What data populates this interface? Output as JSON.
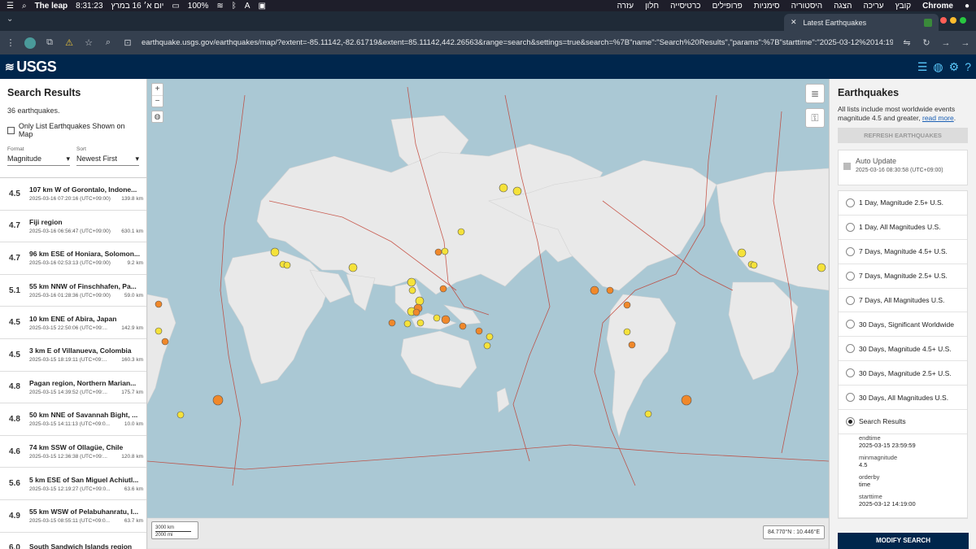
{
  "menubar": {
    "app_name": "The leap",
    "time": "8:31:23",
    "date": "יום א׳ 16 במרץ",
    "battery": "100%",
    "menus": [
      "עזרה",
      "חלון",
      "כרטיסייה",
      "פרופילים",
      "סימניות",
      "היסטוריה",
      "הצגה",
      "עריכה",
      "קובץ"
    ],
    "browser": "Chrome"
  },
  "tab": {
    "title": "Latest Earthquakes"
  },
  "address": {
    "url": "earthquake.usgs.gov/earthquakes/map/?extent=-85.11142,-82.61719&extent=85.11142,442.26563&range=search&settings=true&search=%7B\"name\":\"Search%20Results\",\"params\":%7B\"starttime\":\"2025-03-12%2014:19:..."
  },
  "header": {
    "logo": "USGS"
  },
  "left": {
    "title": "Search Results",
    "count": "36 earthquakes.",
    "only_list_label": "Only List Earthquakes Shown on Map",
    "format_label": "Format",
    "format_value": "Magnitude",
    "sort_label": "Sort",
    "sort_value": "Newest First",
    "quakes": [
      {
        "mag": "4.5",
        "place": "107 km W of Gorontalo, Indone...",
        "time": "2025-03-16 07:20:16 (UTC+09:00)",
        "depth": "139.8 km"
      },
      {
        "mag": "4.7",
        "place": "Fiji region",
        "time": "2025-03-16 06:56:47 (UTC+09:00)",
        "depth": "630.1 km"
      },
      {
        "mag": "4.7",
        "place": "96 km ESE of Honiara, Solomon...",
        "time": "2025-03-16 02:53:13 (UTC+09:00)",
        "depth": "9.2 km"
      },
      {
        "mag": "5.1",
        "place": "55 km NNW of Finschhafen, Pa...",
        "time": "2025-03-16 01:28:36 (UTC+09:00)",
        "depth": "59.0 km"
      },
      {
        "mag": "4.5",
        "place": "10 km ENE of Abira, Japan",
        "time": "2025-03-15 22:50:06 (UTC+09:...",
        "depth": "142.9 km"
      },
      {
        "mag": "4.5",
        "place": "3 km E of Villanueva, Colombia",
        "time": "2025-03-15 18:19:11 (UTC+09:...",
        "depth": "160.3 km"
      },
      {
        "mag": "4.8",
        "place": "Pagan region, Northern Marian...",
        "time": "2025-03-15 14:39:52 (UTC+09:...",
        "depth": "175.7 km"
      },
      {
        "mag": "4.8",
        "place": "50 km NNE of Savannah Bight, ...",
        "time": "2025-03-15 14:11:13 (UTC+09:0...",
        "depth": "10.0 km"
      },
      {
        "mag": "4.6",
        "place": "74 km SSW of Ollagüe, Chile",
        "time": "2025-03-15 12:36:38 (UTC+09:...",
        "depth": "120.8 km"
      },
      {
        "mag": "5.6",
        "place": "5 km ESE of San Miguel Achiutl...",
        "time": "2025-03-15 12:19:27 (UTC+09:0...",
        "depth": "63.6 km"
      },
      {
        "mag": "4.9",
        "place": "55 km WSW of Pelabuhanratu, I...",
        "time": "2025-03-15 08:55:11 (UTC+09:0...",
        "depth": "63.7 km"
      },
      {
        "mag": "6.0",
        "place": "South Sandwich Islands region",
        "time": "",
        "depth": ""
      }
    ]
  },
  "map": {
    "scale_km": "3000 km",
    "scale_mi": "2000 mi",
    "coords": "84.770°N : 10.446°E"
  },
  "right": {
    "title": "Earthquakes",
    "desc": "All lists include most worldwide events magnitude 4.5 and greater,",
    "read_more": "read more",
    "refresh": "REFRESH EARTHQUAKES",
    "auto_update": "Auto Update",
    "auto_update_time": "2025-03-16 08:30:58 (UTC+09:00)",
    "feeds": [
      {
        "label": "1 Day, Magnitude 2.5+ U.S."
      },
      {
        "label": "1 Day, All Magnitudes U.S."
      },
      {
        "label": "7 Days, Magnitude 4.5+ U.S."
      },
      {
        "label": "7 Days, Magnitude 2.5+ U.S."
      },
      {
        "label": "7 Days, All Magnitudes U.S."
      },
      {
        "label": "30 Days, Significant Worldwide"
      },
      {
        "label": "30 Days, Magnitude 4.5+ U.S."
      },
      {
        "label": "30 Days, Magnitude 2.5+ U.S."
      },
      {
        "label": "30 Days, All Magnitudes U.S."
      },
      {
        "label": "Search Results"
      }
    ],
    "params": [
      {
        "k": "endtime",
        "v": "2025-03-15 23:59:59"
      },
      {
        "k": "minmagnitude",
        "v": "4.5"
      },
      {
        "k": "orderby",
        "v": "time"
      },
      {
        "k": "starttime",
        "v": "2025-03-12 14:19:00"
      }
    ],
    "modify": "MODIFY SEARCH"
  },
  "colors": {
    "navy": "#00264c",
    "quake_yellow": "#f5e23a",
    "quake_orange": "#f0882a",
    "plate_line": "#c0392b"
  }
}
